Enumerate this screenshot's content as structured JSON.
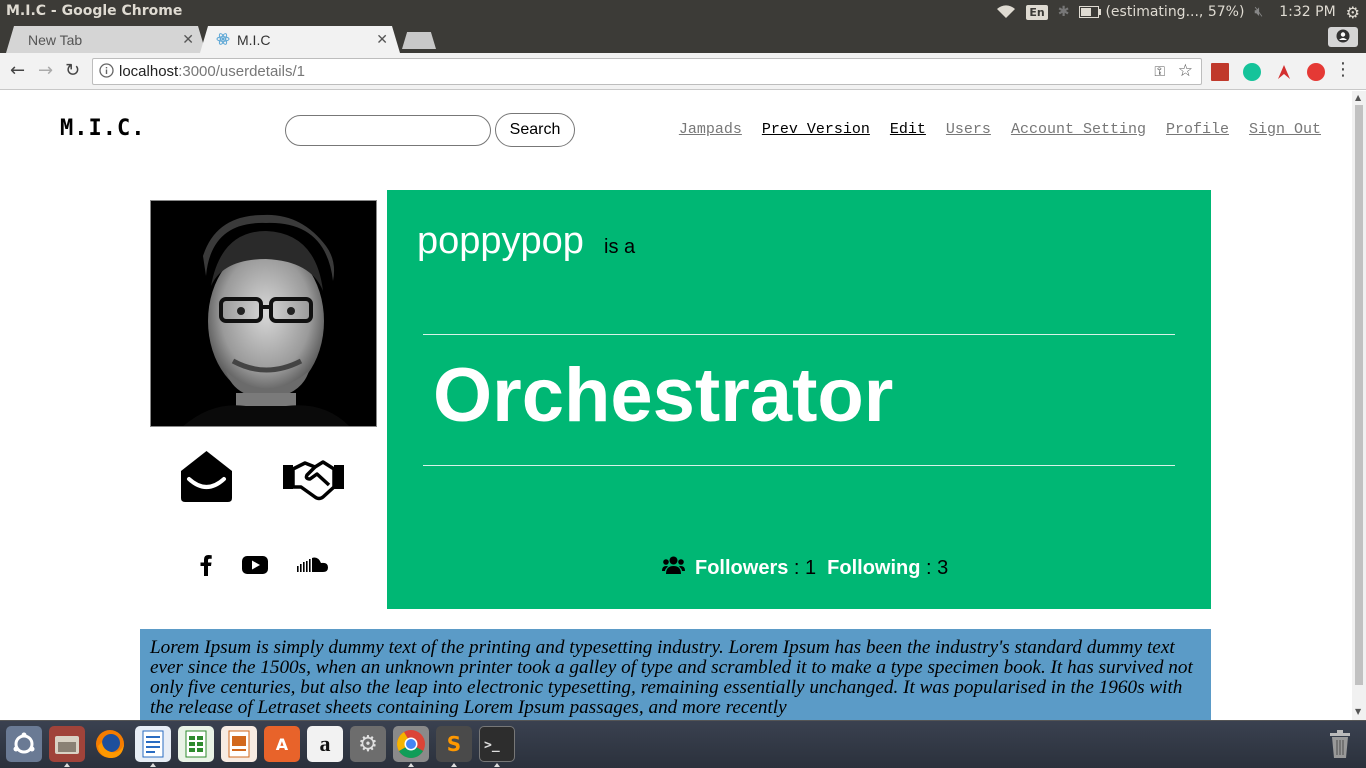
{
  "os": {
    "window_title": "M.I.C - Google Chrome",
    "keyboard_layout": "En",
    "battery_status": "(estimating..., 57%)",
    "clock": "1:32 PM"
  },
  "browser": {
    "tabs": [
      {
        "label": "New Tab"
      },
      {
        "label": "M.I.C"
      }
    ],
    "url_host": "localhost",
    "url_path": ":3000/userdetails/1"
  },
  "site": {
    "logo": "M.I.C.",
    "search_placeholder": "",
    "search_button": "Search",
    "nav": [
      {
        "label": "Jampads"
      },
      {
        "label": "Prev Version"
      },
      {
        "label": "Edit"
      },
      {
        "label": "Users"
      },
      {
        "label": "Account Setting"
      },
      {
        "label": "Profile"
      },
      {
        "label": "Sign Out"
      }
    ]
  },
  "profile": {
    "username": "poppypop",
    "is_a": "is a",
    "role": "Orchestrator",
    "followers_label": "Followers",
    "followers_count": " : 1",
    "following_label": "Following",
    "following_count": " : 3",
    "bio": "Lorem Ipsum is simply dummy text of the printing and typesetting industry. Lorem Ipsum has been the industry's standard dummy text ever since the 1500s, when an unknown printer took a galley of type and scrambled it to make a type specimen book. It has survived not only five centuries, but also the leap into electronic typesetting, remaining essentially unchanged. It was popularised in the 1960s with the release of Letraset sheets containing Lorem Ipsum passages, and more recently"
  },
  "colors": {
    "card": "#00b774",
    "bio_background": "#5b9bc7",
    "os_bar": "#3c3b37"
  },
  "icons": [
    "envelope-open-icon",
    "handshake-icon",
    "facebook-icon",
    "youtube-icon",
    "soundcloud-icon",
    "users-icon"
  ]
}
